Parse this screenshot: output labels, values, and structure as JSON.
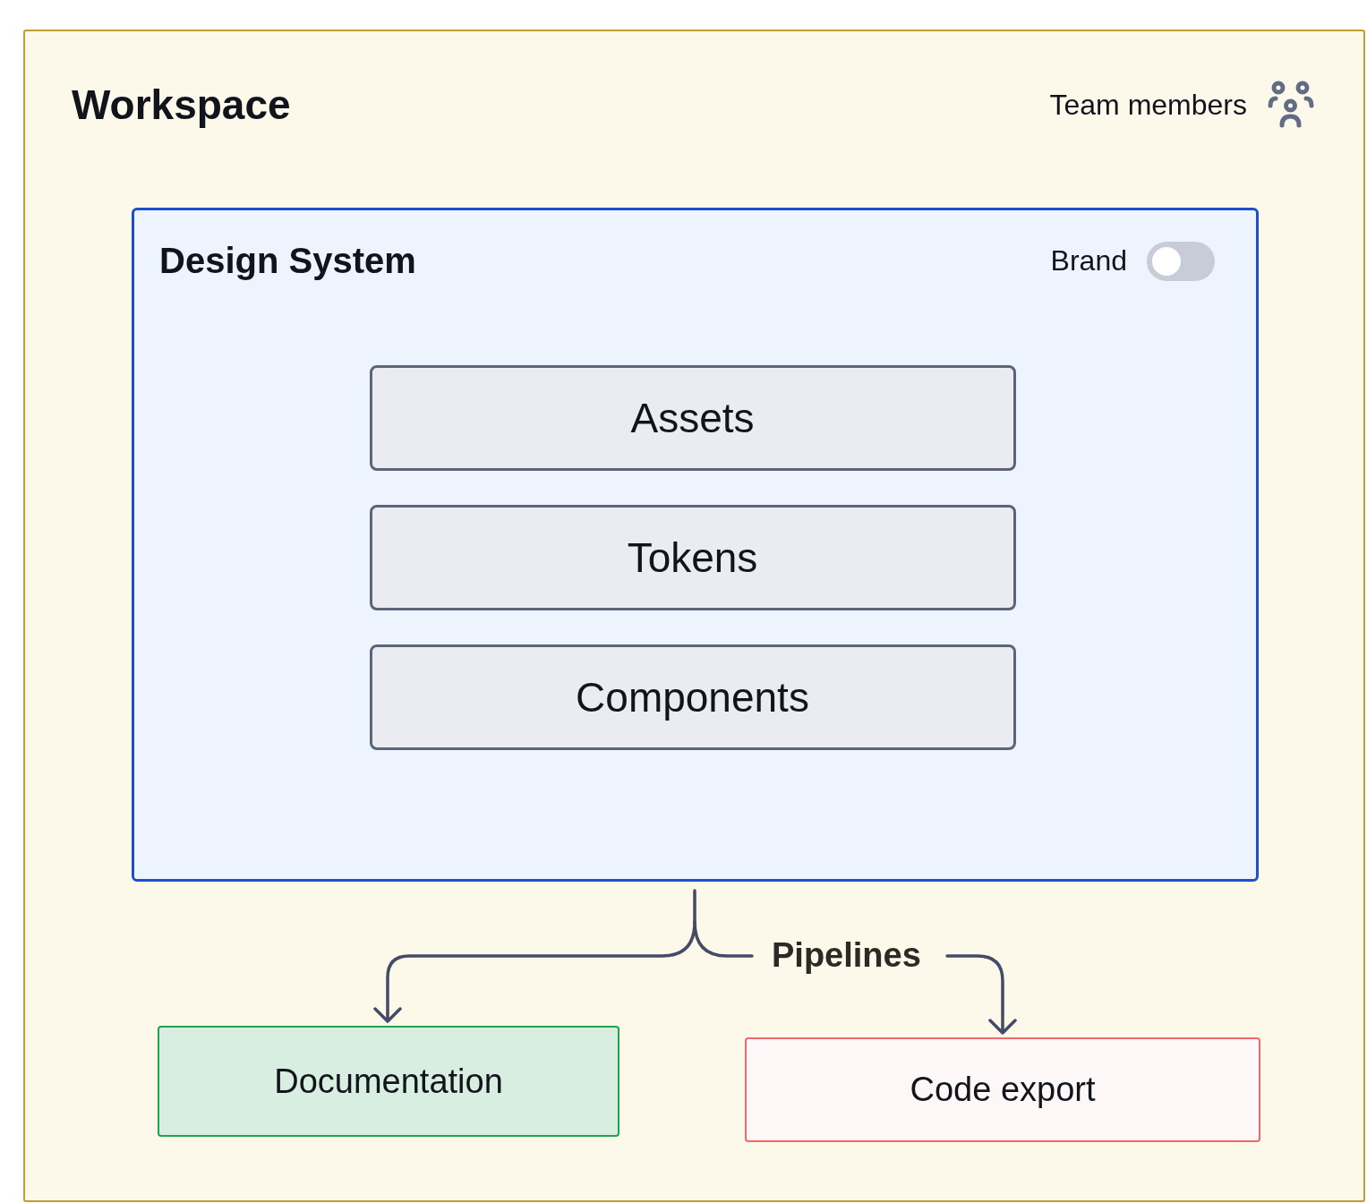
{
  "workspace": {
    "title": "Workspace",
    "team_label": "Team members"
  },
  "design_system": {
    "title": "Design System",
    "toggle": {
      "label": "Brand",
      "on": false
    },
    "items": [
      {
        "label": "Assets"
      },
      {
        "label": "Tokens"
      },
      {
        "label": "Components"
      }
    ]
  },
  "connector": {
    "label": "Pipelines"
  },
  "outputs": [
    {
      "label": "Documentation",
      "color": "#22a352"
    },
    {
      "label": "Code export",
      "color": "#f06868"
    }
  ]
}
